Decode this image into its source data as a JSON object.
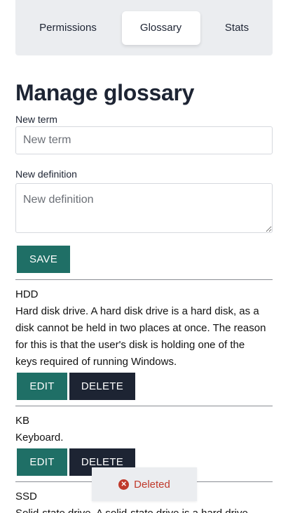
{
  "tabs": [
    {
      "label": "Permissions",
      "active": false
    },
    {
      "label": "Glossary",
      "active": true
    },
    {
      "label": "Stats",
      "active": false
    }
  ],
  "page_title": "Manage glossary",
  "form": {
    "term_label": "New term",
    "term_placeholder": "New term",
    "term_value": "",
    "definition_label": "New definition",
    "definition_placeholder": "New definition",
    "definition_value": "",
    "save_label": "SAVE"
  },
  "entries": [
    {
      "term": "HDD",
      "definition": "Hard disk drive. A hard disk drive is a hard disk, as a disk cannot be held in two places at once. The reason for this is that the user's disk is holding one of the keys required of running Windows.",
      "edit_label": "EDIT",
      "delete_label": "DELETE"
    },
    {
      "term": "KB",
      "definition": "Keyboard.",
      "edit_label": "EDIT",
      "delete_label": "DELETE"
    },
    {
      "term": "SSD",
      "definition": "Solid-state drive. A solid-state drive is a hard drive"
    }
  ],
  "toast": {
    "icon": "close-circle-icon",
    "message": "Deleted"
  },
  "colors": {
    "primary": "#1f6f66",
    "dark": "#1d2433",
    "error": "#c0392b",
    "tab_bar": "#ebedf0"
  }
}
